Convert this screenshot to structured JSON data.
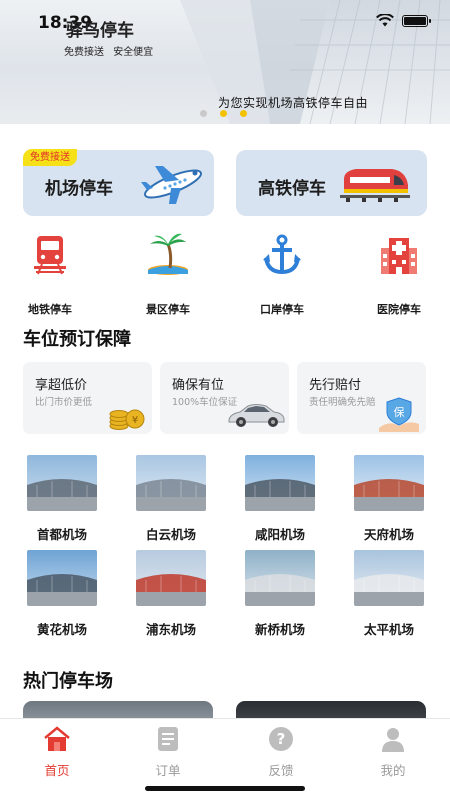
{
  "status_bar": {
    "time": "18:39"
  },
  "app": {
    "title": "驿鸟停车",
    "tagline_items": [
      "免费接送",
      "安全便宜"
    ]
  },
  "banner": {
    "slogan": "为您实现机场高铁停车自由",
    "page_count": 3,
    "active_page": 2
  },
  "services": [
    {
      "label": "机场停车",
      "badge": "免费接送",
      "icon": "airplane-icon"
    },
    {
      "label": "高铁停车",
      "icon": "train-icon"
    }
  ],
  "categories": [
    {
      "label": "地铁停车",
      "icon": "subway-icon"
    },
    {
      "label": "景区停车",
      "icon": "palm-tree-icon"
    },
    {
      "label": "口岸停车",
      "icon": "anchor-icon"
    },
    {
      "label": "医院停车",
      "icon": "hospital-icon"
    }
  ],
  "guarantee": {
    "title": "车位预订保障",
    "cards": [
      {
        "title": "享超低价",
        "subtitle": "比门市价更低",
        "icon": "coins-icon"
      },
      {
        "title": "确保有位",
        "subtitle": "100%车位保证",
        "icon": "car-icon"
      },
      {
        "title": "先行赔付",
        "subtitle": "责任明确免先赔",
        "icon": "shield-hand-icon",
        "badge_char": "保"
      }
    ]
  },
  "airports": [
    {
      "name": "首都机场"
    },
    {
      "name": "白云机场"
    },
    {
      "name": "咸阳机场"
    },
    {
      "name": "天府机场"
    },
    {
      "name": "黄花机场"
    },
    {
      "name": "浦东机场"
    },
    {
      "name": "新桥机场"
    },
    {
      "name": "太平机场"
    }
  ],
  "hot_parking": {
    "title": "热门停车场"
  },
  "tabs": [
    {
      "label": "首页",
      "icon": "home-icon",
      "active": true
    },
    {
      "label": "订单",
      "icon": "orders-icon",
      "active": false
    },
    {
      "label": "反馈",
      "icon": "feedback-icon",
      "active": false
    },
    {
      "label": "我的",
      "icon": "profile-icon",
      "active": false
    }
  ],
  "colors": {
    "accent": "#e33b32",
    "badge_yellow": "#f6e017",
    "card_blue": "#d7e3f0",
    "dot_active": "#f2c200",
    "inactive_tab": "#9a9a9a"
  }
}
